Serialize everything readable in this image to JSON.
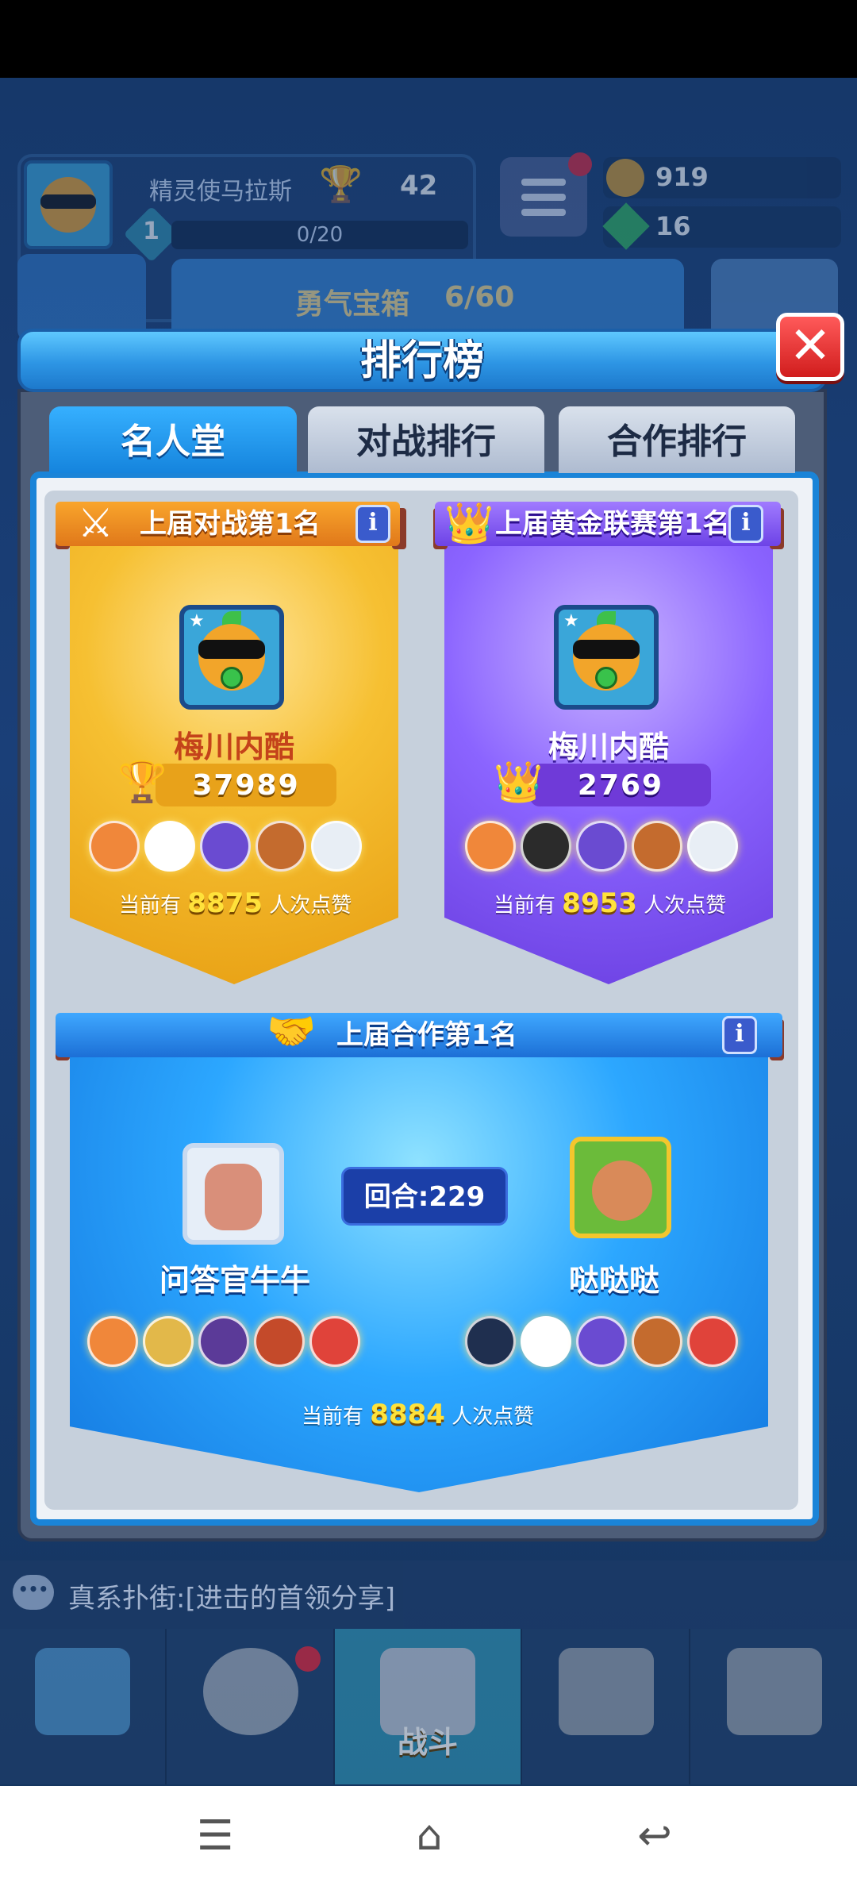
{
  "hud": {
    "player_name": "精灵使马拉斯",
    "trophies": "42",
    "level": "1",
    "xp": "0/20",
    "coins": "919",
    "gems": "16",
    "courage_chest_label": "勇气宝箱",
    "courage_chest_count": "6/60"
  },
  "modal": {
    "title": "排行榜",
    "close_symbol": "✕",
    "tabs": [
      {
        "label": "名人堂"
      },
      {
        "label": "对战排行"
      },
      {
        "label": "合作排行"
      }
    ]
  },
  "battle_card": {
    "title": "上届对战第1名",
    "player_name": "梅川内酷",
    "score": "37989",
    "likes_prefix": "当前有",
    "likes_count": "8875",
    "likes_suffix": "人次点赞",
    "color": "#f6c032"
  },
  "league_card": {
    "title": "上届黄金联赛第1名",
    "player_name": "梅川内酷",
    "score": "2769",
    "likes_prefix": "当前有",
    "likes_count": "8953",
    "likes_suffix": "人次点赞",
    "color": "#8b64ff"
  },
  "coop_card": {
    "title": "上届合作第1名",
    "player1_name": "问答官牛牛",
    "player2_name": "哒哒哒",
    "round_label": "回合:229",
    "likes_prefix": "当前有",
    "likes_count": "8884",
    "likes_suffix": "人次点赞",
    "color": "#2ca7ff"
  },
  "chat": {
    "message": "真系扑街:[进击的首领分享]"
  },
  "bottom_nav": {
    "active_label": "战斗"
  },
  "info_symbol": "i"
}
